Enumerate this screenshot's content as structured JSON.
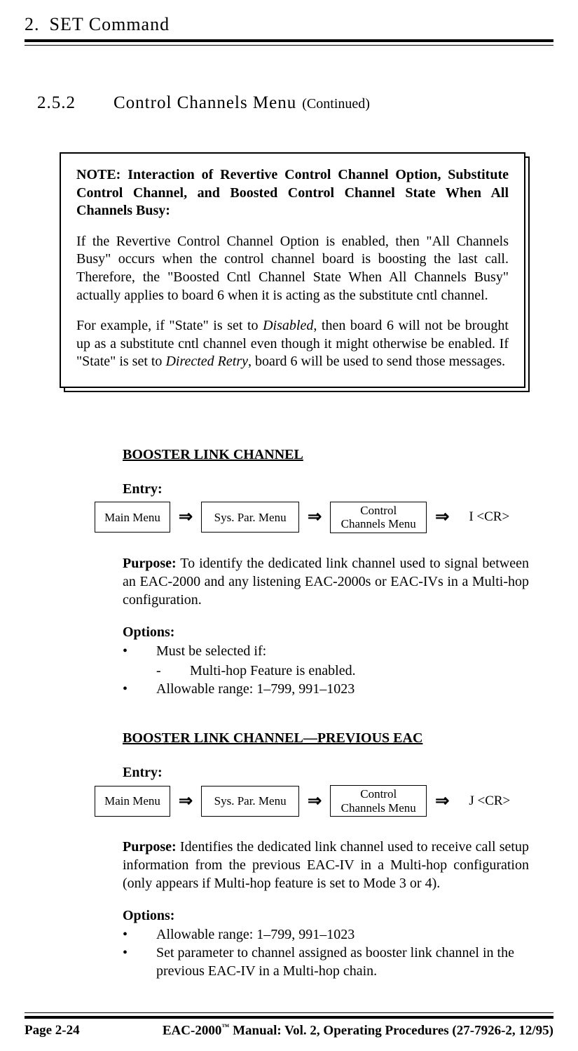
{
  "header": {
    "chapter_number": "2.",
    "chapter_title": "SET Command"
  },
  "subsection": {
    "number": "2.5.2",
    "title": "Control Channels Menu",
    "continued": "(Continued)"
  },
  "note": {
    "title": "NOTE:  Interaction of Revertive Control Channel Option, Substitute Control Channel, and Boosted Control Channel State When All Channels Busy:",
    "para1": "If the Revertive Control Channel Option is enabled, then \"All Channels Busy\" occurs when the control channel board is boosting the last call.  Therefore, the \"Boosted Cntl Channel State When All Channels Busy\" actually applies to board 6 when it is acting as the substitute cntl channel.",
    "para2_pre": "For example, if \"State\" is set to ",
    "para2_ital1": "Disabled",
    "para2_mid": ", then board 6 will not be brought up as a substitute cntl channel even though it might otherwise be enabled.  If \"State\" is set to ",
    "para2_ital2": "Directed Retry",
    "para2_post": ", board 6 will be used to send those messages."
  },
  "labels": {
    "entry": "Entry:",
    "options": "Options:",
    "purpose_lead": "Purpose:",
    "bullet": "•",
    "dash": "-",
    "arrow": "⇒"
  },
  "menu_boxes": {
    "main": "Main Menu",
    "sys": "Sys. Par. Menu",
    "ctrl_line1": "Control",
    "ctrl_line2": "Channels Menu"
  },
  "param1": {
    "title": "BOOSTER LINK CHANNEL",
    "keystroke": "I <CR>",
    "purpose": "  To identify the dedicated link channel used to signal between an EAC-2000 and any listening EAC-2000s or EAC-IVs in a Multi-hop configuration.",
    "opt1": "Must be selected if:",
    "opt1_sub": "Multi-hop Feature is enabled.",
    "opt2": "Allowable range:  1–799, 991–1023"
  },
  "param2": {
    "title": "BOOSTER LINK CHANNEL—PREVIOUS EAC",
    "keystroke": "J <CR>",
    "purpose": "  Identifies the dedicated link channel used to receive call setup information from the previous EAC-IV in a Multi-hop configuration (only appears if Multi-hop feature is set to Mode 3 or 4).",
    "opt1": "Allowable range:  1–799, 991–1023",
    "opt2": "Set parameter to channel assigned as booster link channel in the previous EAC-IV in a Multi-hop chain."
  },
  "footer": {
    "page": "Page 2-24",
    "manual_pre": "EAC-2000",
    "tm": "™",
    "manual_post": " Manual:  Vol. 2, Operating Procedures (27-7926-2, 12/95)"
  }
}
